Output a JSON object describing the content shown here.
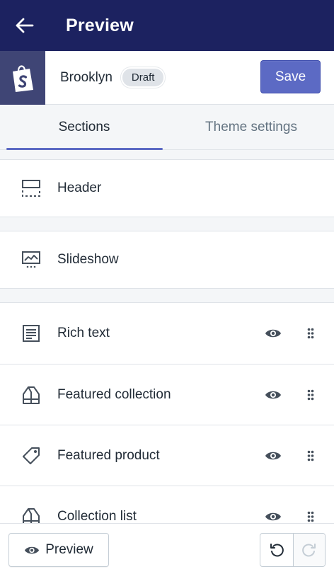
{
  "topbar": {
    "title": "Preview",
    "back_icon": "arrow-left-icon"
  },
  "themebar": {
    "theme_name": "Brooklyn",
    "badge": "Draft",
    "save_label": "Save",
    "logo_icon": "shopify-bag-icon"
  },
  "tabs": [
    {
      "label": "Sections",
      "active": true
    },
    {
      "label": "Theme settings",
      "active": false
    }
  ],
  "static_sections": [
    {
      "label": "Header",
      "icon": "header-layout-icon"
    },
    {
      "label": "Slideshow",
      "icon": "slideshow-icon"
    }
  ],
  "sections": [
    {
      "label": "Rich text",
      "icon": "rich-text-icon"
    },
    {
      "label": "Featured collection",
      "icon": "collection-icon"
    },
    {
      "label": "Featured product",
      "icon": "tag-icon"
    },
    {
      "label": "Collection list",
      "icon": "collection-icon"
    }
  ],
  "footer": {
    "preview_label": "Preview",
    "undo_icon": "undo-icon",
    "redo_icon": "redo-icon"
  },
  "colors": {
    "topbar": "#1c2260",
    "accent": "#5c6ac4",
    "logo_bg": "#3f4575"
  }
}
